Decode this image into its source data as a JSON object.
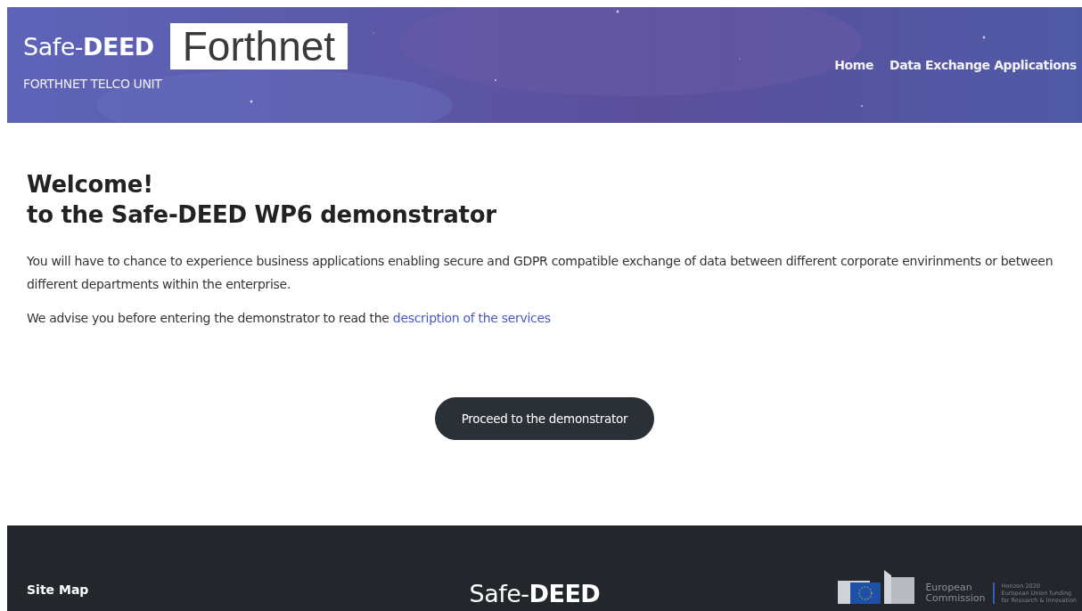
{
  "header": {
    "brand_light": "Safe-",
    "brand_bold": "DEED",
    "partner_logo": "Forthnet",
    "subtitle": "FORTHNET TELCO UNIT",
    "nav": [
      {
        "label": "Home"
      },
      {
        "label": "Data Exchange Applications"
      }
    ]
  },
  "main": {
    "heading_lines": [
      "Welcome!",
      "to the Safe-DEED WP6 demonstrator"
    ],
    "intro": "You will have to chance to experience business applications enabling secure and GDPR compatible exchange of data between different corporate envirinments or between different departments within the enterprise.",
    "advice": "We advise you before entering the demonstrator to read the ",
    "advice_link": "description of the services",
    "button": "Proceed to the demonstrator"
  },
  "footer": {
    "site_map": "Site Map",
    "brand_light": "Safe-",
    "brand_bold": "DEED",
    "ec_lines": [
      "European",
      "Commission"
    ],
    "horizon_lines": [
      "Horizon 2020",
      "European Union funding",
      "for Research & Innovation"
    ]
  }
}
